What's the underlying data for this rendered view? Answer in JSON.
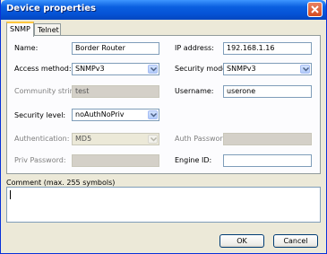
{
  "window": {
    "title": "Device properties"
  },
  "tabs": [
    {
      "label": "SNMP"
    },
    {
      "label": "Telnet"
    }
  ],
  "form": {
    "name": {
      "label": "Name:",
      "value": "Border Router"
    },
    "ip_address": {
      "label": "IP address:",
      "value": "192.168.1.16"
    },
    "access_method": {
      "label": "Access method:",
      "value": "SNMPv3"
    },
    "security_model": {
      "label": "Security model:",
      "value": "SNMPv3"
    },
    "community_string": {
      "label": "Community string:",
      "value": "test"
    },
    "username": {
      "label": "Username:",
      "value": "userone"
    },
    "security_level": {
      "label": "Security level:",
      "value": "noAuthNoPriv"
    },
    "authentication": {
      "label": "Authentication:",
      "value": "MD5"
    },
    "auth_password": {
      "label": "Auth Password:",
      "value": ""
    },
    "priv_password": {
      "label": "Priv Password:",
      "value": ""
    },
    "engine_id": {
      "label": "Engine ID:",
      "value": ""
    }
  },
  "comment": {
    "label": "Comment (max. 255 symbols)",
    "value": ""
  },
  "buttons": {
    "ok": "OK",
    "cancel": "Cancel"
  },
  "colors": {
    "titlebar": "#0553D6",
    "dialog_bg": "#ECE9D8",
    "tab_highlight": "#FFC73C",
    "close_button": "#D54B1E"
  }
}
